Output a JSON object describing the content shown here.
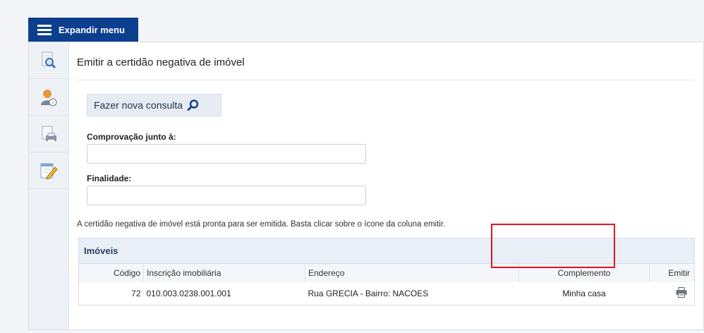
{
  "menu": {
    "expand_label": "Expandir menu"
  },
  "sidebar": {
    "items": [
      {
        "icon": "document-search-icon"
      },
      {
        "icon": "user-info-icon"
      },
      {
        "icon": "printer-document-icon"
      },
      {
        "icon": "edit-document-icon"
      }
    ]
  },
  "page": {
    "title": "Emitir a certidão negativa de imóvel"
  },
  "actions": {
    "new_query_label": "Fazer nova consulta"
  },
  "form": {
    "comprovacao_label": "Comprovação junto à:",
    "comprovacao_value": "",
    "finalidade_label": "Finalidade:",
    "finalidade_value": ""
  },
  "info_text": "A certidão negativa de imóvel está pronta para ser emitida. Basta clicar sobre o ícone da coluna emitir.",
  "grid": {
    "title": "Imóveis",
    "columns": [
      "Código",
      "Inscrição imobiliária",
      "Endereço",
      "Complemento",
      "Emitir"
    ],
    "rows": [
      {
        "codigo": "72",
        "inscricao": "010.003.0238.001.001",
        "endereco": "Rua GRECIA - Bairro: NACOES",
        "complemento": "Minha casa"
      }
    ]
  },
  "colors": {
    "menu_bg": "#0d3f8f",
    "highlight": "#e0141e",
    "grid_header_bg": "#e8eff7"
  }
}
